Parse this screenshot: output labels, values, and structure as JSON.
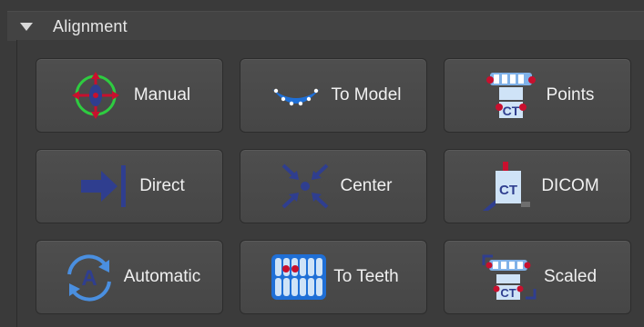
{
  "section": {
    "title": "Alignment"
  },
  "buttons": [
    {
      "label": "Manual",
      "icon": "manual-transform-icon"
    },
    {
      "label": "To Model",
      "icon": "arch-points-icon"
    },
    {
      "label": "Points",
      "icon": "ct-points-icon"
    },
    {
      "label": "Direct",
      "icon": "arrow-to-line-icon"
    },
    {
      "label": "Center",
      "icon": "converge-center-icon"
    },
    {
      "label": "DICOM",
      "icon": "ct-dicom-icon"
    },
    {
      "label": "Automatic",
      "icon": "automatic-cycle-icon"
    },
    {
      "label": "To Teeth",
      "icon": "teeth-points-icon"
    },
    {
      "label": "Scaled",
      "icon": "ct-scaled-icon"
    }
  ],
  "colors": {
    "icon_blue": "#2f3e8f",
    "icon_red": "#c8102e",
    "icon_green": "#2ecc40",
    "ct_light": "#cfe3f7"
  }
}
